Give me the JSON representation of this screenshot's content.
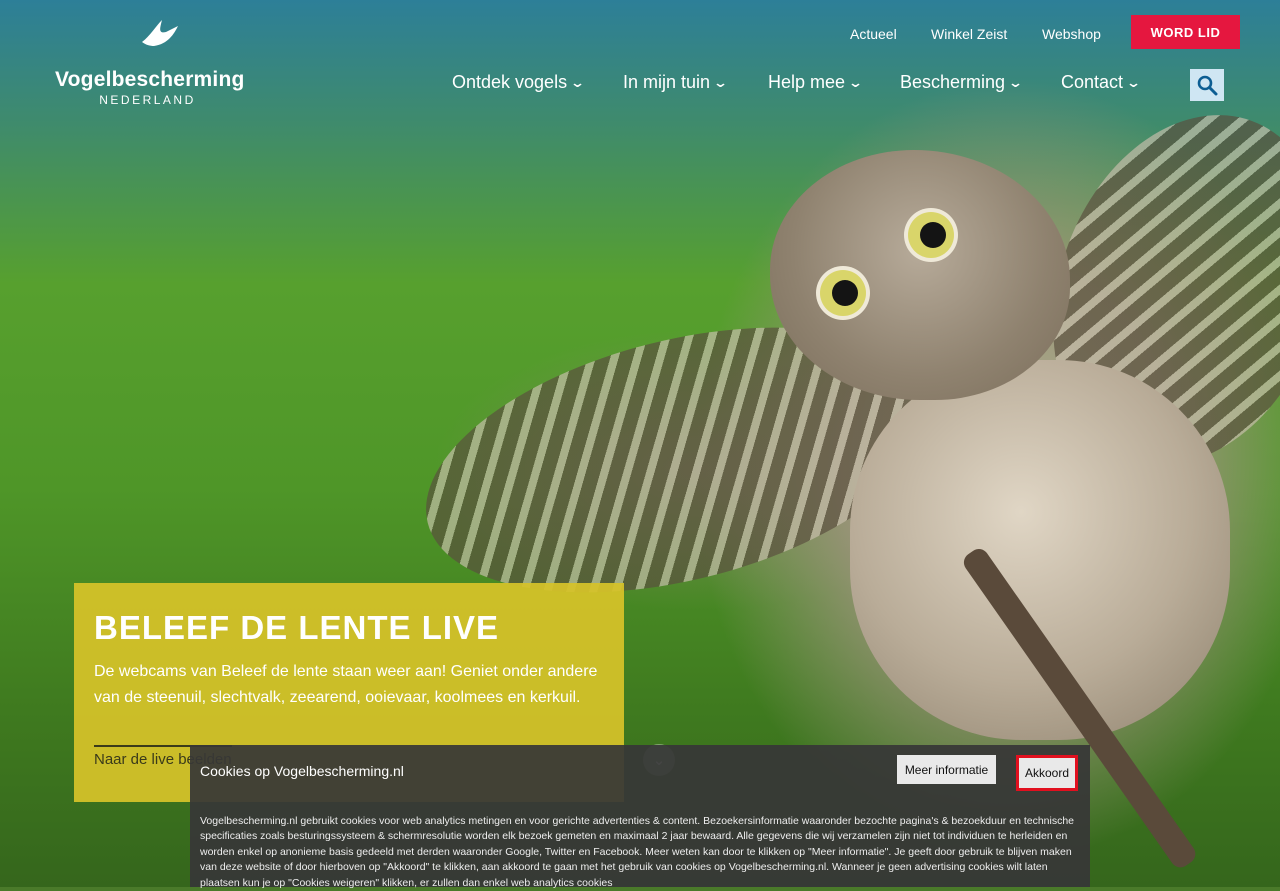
{
  "logo": {
    "name": "Vogelbescherming",
    "sub": "NEDERLAND"
  },
  "topnav": {
    "actueel": "Actueel",
    "winkel": "Winkel Zeist",
    "webshop": "Webshop",
    "word_lid": "WORD LID"
  },
  "mainnav": {
    "items": [
      {
        "label": "Ontdek vogels"
      },
      {
        "label": "In mijn tuin"
      },
      {
        "label": "Help mee"
      },
      {
        "label": "Bescherming"
      },
      {
        "label": "Contact"
      }
    ]
  },
  "hero": {
    "title": "BELEEF DE LENTE LIVE",
    "text": "De webcams van Beleef de lente staan weer aan! Geniet onder andere van de steenuil, slechtvalk, zeearend, ooievaar, koolmees en kerkuil.",
    "link": "Naar de live beelden"
  },
  "cookie": {
    "title": "Cookies op Vogelbescherming.nl",
    "meer": "Meer informatie",
    "akkoord": "Akkoord",
    "text": "Vogelbescherming.nl gebruikt cookies voor web analytics metingen en voor gerichte advertenties & content. Bezoekersinformatie waaronder bezochte pagina's & bezoekduur en technische specificaties zoals besturingssysteem & schermresolutie worden elk bezoek gemeten en maximaal 2 jaar bewaard. Alle gegevens die wij verzamelen zijn niet tot individuen te herleiden en worden enkel op anonieme basis gedeeld met derden waaronder Google, Twitter en Facebook. Meer weten kan door te klikken op \"Meer informatie\". Je geeft door gebruik te blijven maken van deze website of door hierboven op \"Akkoord\" te klikken, aan akkoord te gaan met het gebruik van cookies op Vogelbescherming.nl. Wanneer je geen advertising cookies wilt laten plaatsen kun je op \"Cookies weigeren\" klikken, er zullen dan enkel web analytics cookies"
  }
}
